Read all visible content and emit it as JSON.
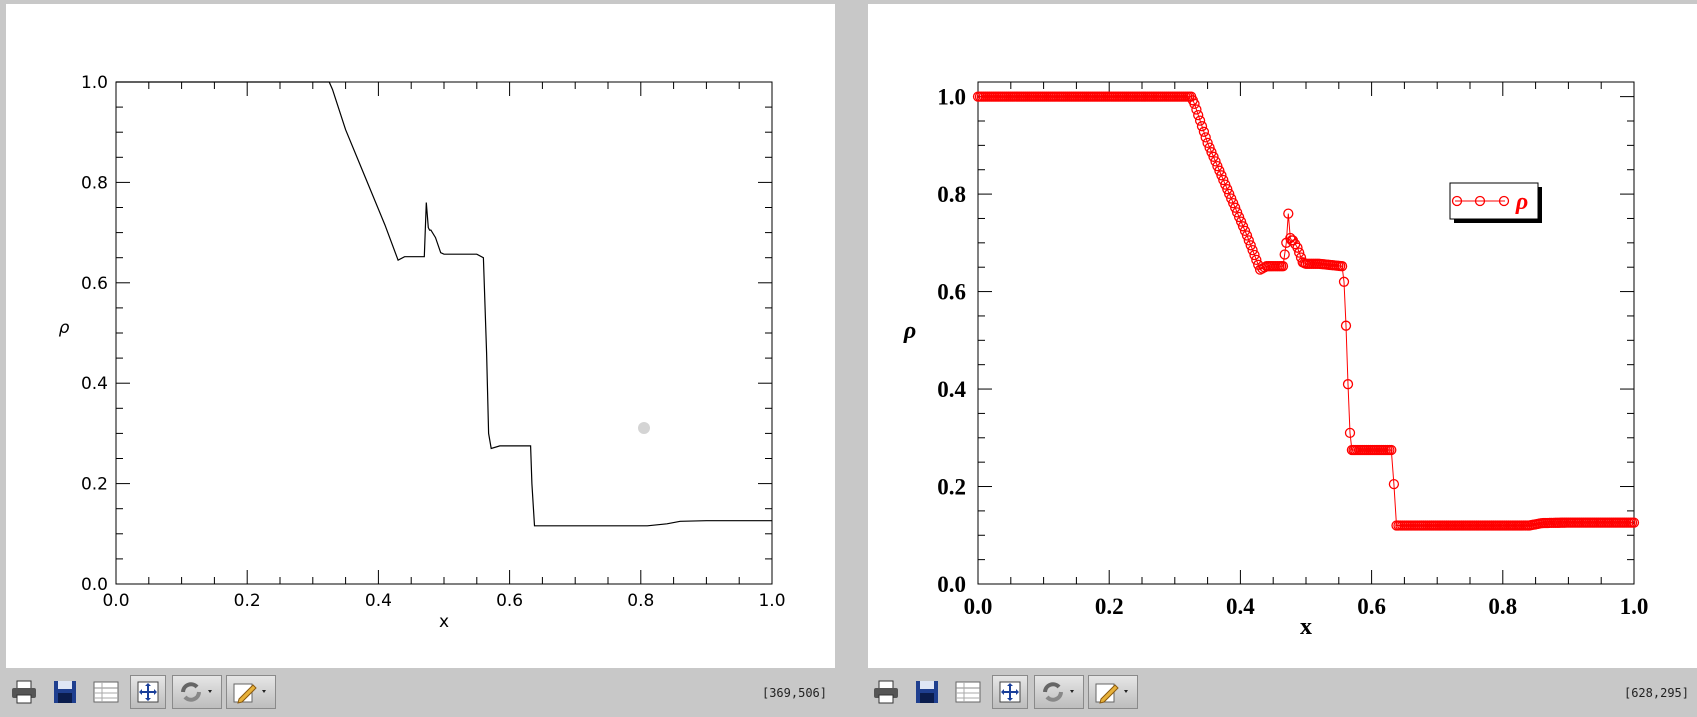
{
  "colors": {
    "left_line": "#000000",
    "right_marker": "#ff0000",
    "background": "#ffffff",
    "chrome": "#c8c8c8"
  },
  "toolbar": {
    "icons": [
      "print-icon",
      "save-icon",
      "table-icon",
      "zoom-fit-icon",
      "refresh-icon",
      "edit-icon"
    ]
  },
  "chart_data": [
    {
      "type": "line",
      "xlabel": "x",
      "ylabel": "ρ",
      "xlim": [
        0.0,
        1.0
      ],
      "ylim": [
        0.0,
        1.0
      ],
      "x_ticks": [
        "0.0",
        "0.2",
        "0.4",
        "0.6",
        "0.8",
        "1.0"
      ],
      "y_ticks": [
        "0.0",
        "0.2",
        "0.4",
        "0.6",
        "0.8",
        "1.0"
      ],
      "grid": false,
      "cursor_readout": "[369,506]",
      "series": [
        {
          "color": "#000000",
          "x": [
            0.0,
            0.325,
            0.33,
            0.35,
            0.38,
            0.41,
            0.43,
            0.44,
            0.45,
            0.465,
            0.47,
            0.473,
            0.476,
            0.478,
            0.48,
            0.487,
            0.495,
            0.5,
            0.52,
            0.55,
            0.56,
            0.565,
            0.568,
            0.572,
            0.585,
            0.632,
            0.634,
            0.638,
            0.7,
            0.78,
            0.81,
            0.84,
            0.86,
            0.9,
            1.0
          ],
          "y": [
            1.0,
            1.0,
            0.985,
            0.905,
            0.81,
            0.715,
            0.645,
            0.652,
            0.652,
            0.652,
            0.652,
            0.76,
            0.71,
            0.705,
            0.705,
            0.69,
            0.66,
            0.657,
            0.657,
            0.657,
            0.65,
            0.46,
            0.3,
            0.27,
            0.275,
            0.275,
            0.2,
            0.116,
            0.116,
            0.116,
            0.116,
            0.12,
            0.125,
            0.126,
            0.126
          ]
        }
      ]
    },
    {
      "type": "scatter",
      "xlabel": "x",
      "ylabel": "ρ",
      "xlim": [
        0.0,
        1.0
      ],
      "ylim": [
        0.0,
        1.03
      ],
      "x_ticks": [
        "0.0",
        "0.2",
        "0.4",
        "0.6",
        "0.8",
        "1.0"
      ],
      "y_ticks": [
        "0.0",
        "0.2",
        "0.4",
        "0.6",
        "0.8",
        "1.0"
      ],
      "grid": false,
      "legend": "top-right",
      "cursor_readout": "[628,295]",
      "series": [
        {
          "name": "ρ",
          "color": "#ff0000",
          "marker": "open-circle",
          "x": [
            0.0,
            0.325,
            0.33,
            0.35,
            0.38,
            0.41,
            0.43,
            0.44,
            0.465,
            0.47,
            0.473,
            0.476,
            0.478,
            0.48,
            0.487,
            0.495,
            0.5,
            0.52,
            0.555,
            0.558,
            0.561,
            0.564,
            0.567,
            0.57,
            0.575,
            0.63,
            0.634,
            0.638,
            0.7,
            0.8,
            0.84,
            0.86,
            0.9,
            1.0
          ],
          "y": [
            1.0,
            1.0,
            0.985,
            0.905,
            0.81,
            0.715,
            0.645,
            0.652,
            0.652,
            0.7,
            0.76,
            0.71,
            0.705,
            0.705,
            0.69,
            0.66,
            0.657,
            0.657,
            0.652,
            0.62,
            0.53,
            0.41,
            0.31,
            0.275,
            0.275,
            0.275,
            0.205,
            0.12,
            0.12,
            0.12,
            0.12,
            0.125,
            0.126,
            0.126
          ]
        }
      ]
    }
  ]
}
